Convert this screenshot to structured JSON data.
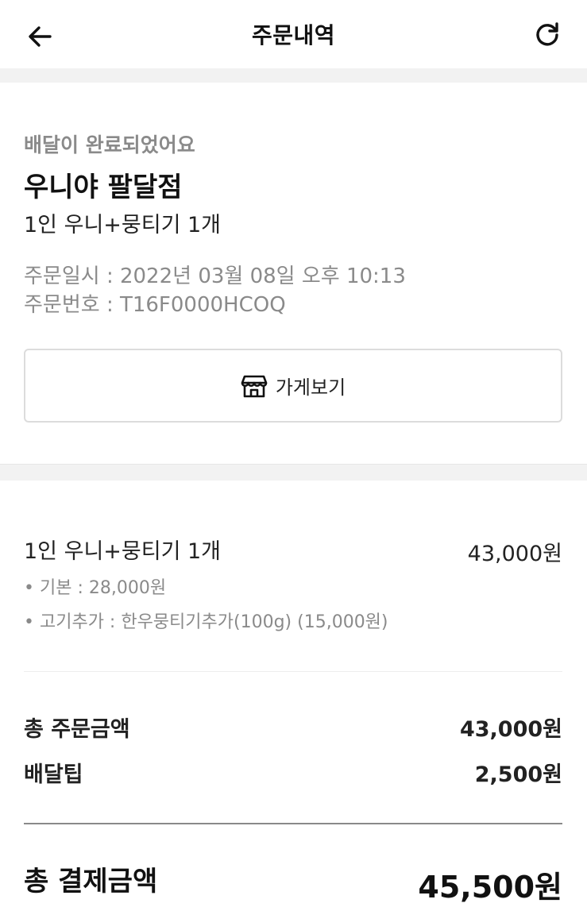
{
  "header": {
    "title": "주문내역",
    "back_icon": "arrow-left-icon",
    "refresh_icon": "refresh-icon"
  },
  "order": {
    "status": "배달이 완료되었어요",
    "store_name": "우니야 팔달점",
    "menu_summary": "1인 우니+뭉티기 1개",
    "order_date": "주문일시 : 2022년 03월 08일 오후 10:13",
    "order_number": "주문번호 : T16F0000HCOQ",
    "store_button_label": "가게보기",
    "store_button_icon": "store-icon"
  },
  "items": [
    {
      "name": "1인 우니+뭉티기 1개",
      "price": "43,000원",
      "options": [
        "• 기본 : 28,000원",
        "• 고기추가 : 한우뭉티기추가(100g) (15,000원)"
      ]
    }
  ],
  "summary": {
    "order_total_label": "총 주문금액",
    "order_total_value": "43,000원",
    "delivery_tip_label": "배달팁",
    "delivery_tip_value": "2,500원",
    "payment_total_label": "총 결제금액",
    "payment_total_value": "45,500원"
  }
}
